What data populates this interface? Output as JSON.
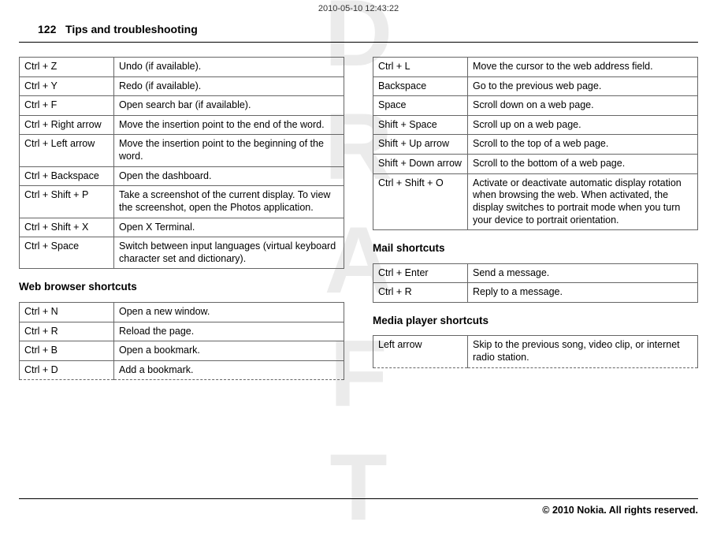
{
  "timestamp": "2010-05-10 12:43:22",
  "page_number": "122",
  "page_title": "Tips and troubleshooting",
  "watermark": "DRAFT",
  "footer": "© 2010 Nokia. All rights reserved.",
  "general_shortcuts": [
    {
      "key": "Ctrl + Z",
      "desc": "Undo (if available)."
    },
    {
      "key": "Ctrl + Y",
      "desc": "Redo (if available)."
    },
    {
      "key": "Ctrl + F",
      "desc": "Open search bar (if available)."
    },
    {
      "key": "Ctrl + Right arrow",
      "desc": "Move the insertion point to the end of the word."
    },
    {
      "key": "Ctrl + Left arrow",
      "desc": "Move the insertion point to the beginning of the word."
    },
    {
      "key": "Ctrl + Backspace",
      "desc": "Open the dashboard."
    },
    {
      "key": "Ctrl + Shift + P",
      "desc": "Take a screenshot of the current display. To view the screenshot, open the Photos application."
    },
    {
      "key": "Ctrl + Shift + X",
      "desc": "Open X Terminal."
    },
    {
      "key": "Ctrl + Space",
      "desc": "Switch between input languages (virtual keyboard character set and dictionary)."
    }
  ],
  "web_title": "Web browser shortcuts",
  "web_shortcuts_a": [
    {
      "key": "Ctrl + N",
      "desc": "Open a new window."
    },
    {
      "key": "Ctrl + R",
      "desc": "Reload the page."
    },
    {
      "key": "Ctrl + B",
      "desc": "Open a bookmark."
    },
    {
      "key": "Ctrl + D",
      "desc": "Add a bookmark."
    }
  ],
  "web_shortcuts_b": [
    {
      "key": "Ctrl + L",
      "desc": "Move the cursor to the web address field."
    },
    {
      "key": "Backspace",
      "desc": "Go to the previous web page."
    },
    {
      "key": "Space",
      "desc": "Scroll down on a web page."
    },
    {
      "key": "Shift + Space",
      "desc": "Scroll up on a web page."
    },
    {
      "key": "Shift + Up arrow",
      "desc": "Scroll to the top of a web page."
    },
    {
      "key": "Shift + Down arrow",
      "desc": "Scroll to the bottom of a web page."
    },
    {
      "key": "Ctrl + Shift + O",
      "desc": "Activate or deactivate automatic display rotation when browsing the web. When activated, the display switches to portrait mode when you turn your device to portrait orientation."
    }
  ],
  "mail_title": "Mail shortcuts",
  "mail_shortcuts": [
    {
      "key": "Ctrl + Enter",
      "desc": "Send a message."
    },
    {
      "key": "Ctrl + R",
      "desc": "Reply to a message."
    }
  ],
  "media_title": "Media player shortcuts",
  "media_shortcuts": [
    {
      "key": "Left arrow",
      "desc": "Skip to the previous song, video clip, or internet radio station."
    }
  ]
}
